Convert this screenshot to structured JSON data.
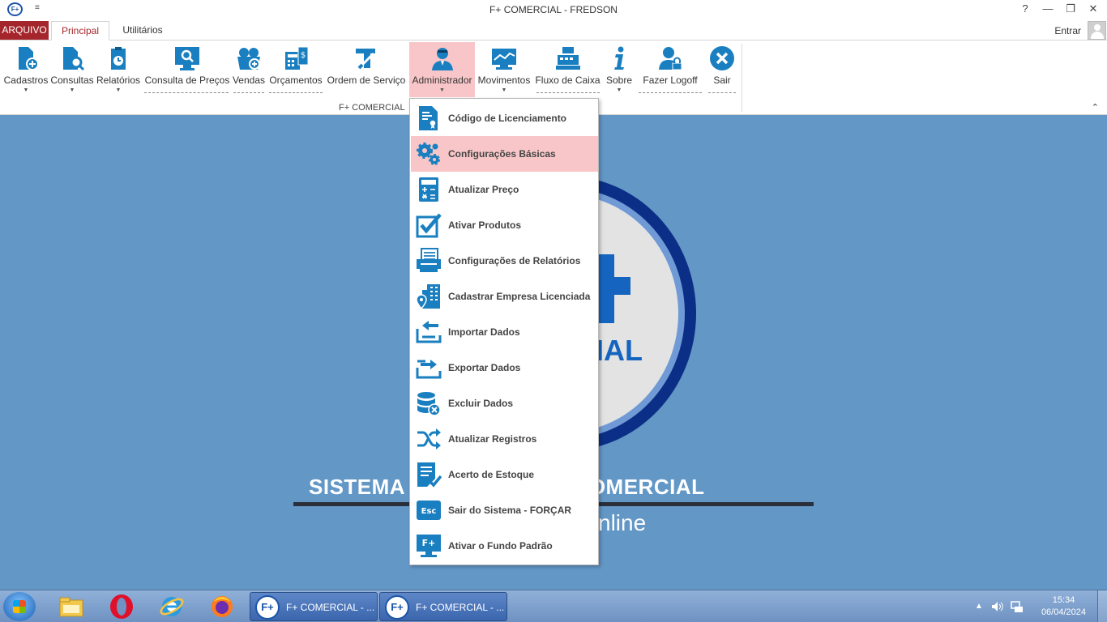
{
  "window": {
    "title": "F+ COMERCIAL - FREDSON",
    "app_icon_label": "F+",
    "quick_access": "≡",
    "controls": [
      "?",
      "—",
      "❐",
      "✕"
    ]
  },
  "tabs": {
    "file": "ARQUIVO",
    "items": [
      "Principal",
      "Utilitários"
    ],
    "active": "Principal",
    "signin": "Entrar"
  },
  "ribbon": {
    "buttons": [
      {
        "label": "Cadastros",
        "icon": "document-plus-icon",
        "has_arrow": true
      },
      {
        "label": "Consultas",
        "icon": "document-search-icon",
        "has_arrow": true
      },
      {
        "label": "Relatórios",
        "icon": "clipboard-clock-icon",
        "has_arrow": true
      },
      {
        "label": "Consulta de Preços",
        "icon": "monitor-search-icon",
        "has_arrow": false
      },
      {
        "label": "Vendas",
        "icon": "basket-plus-icon",
        "has_arrow": false
      },
      {
        "label": "Orçamentos",
        "icon": "calculator-document-icon",
        "has_arrow": false
      },
      {
        "label": "Ordem de Serviço",
        "icon": "tools-icon",
        "has_arrow": false
      },
      {
        "label": "Administrador",
        "icon": "admin-user-icon",
        "has_arrow": true
      },
      {
        "label": "Movimentos",
        "icon": "monitor-chart-icon",
        "has_arrow": true
      },
      {
        "label": "Fluxo de Caixa",
        "icon": "cash-register-icon",
        "has_arrow": false
      },
      {
        "label": "Sobre",
        "icon": "info-icon",
        "has_arrow": true
      },
      {
        "label": "Fazer Logoff",
        "icon": "user-lock-icon",
        "has_arrow": false
      },
      {
        "label": "Sair",
        "icon": "close-circle-icon",
        "has_arrow": false
      }
    ],
    "group_label": "F+ COMERCIAL",
    "collapse_icon": "⌃"
  },
  "menu": {
    "items": [
      {
        "label": "Código de Licenciamento",
        "icon": "license-certificate-icon"
      },
      {
        "label": "Configurações Básicas",
        "icon": "gears-icon",
        "highlighted": true
      },
      {
        "label": "Atualizar Preço",
        "icon": "calculator-icon"
      },
      {
        "label": "Ativar Produtos",
        "icon": "checkbox-icon"
      },
      {
        "label": "Configurações de Relatórios",
        "icon": "printer-report-icon"
      },
      {
        "label": "Cadastrar Empresa Licenciada",
        "icon": "building-location-icon"
      },
      {
        "label": "Importar Dados",
        "icon": "import-icon"
      },
      {
        "label": "Exportar Dados",
        "icon": "export-icon"
      },
      {
        "label": "Excluir Dados",
        "icon": "database-delete-icon"
      },
      {
        "label": "Atualizar Registros",
        "icon": "shuffle-icon"
      },
      {
        "label": "Acerto de Estoque",
        "icon": "stock-list-icon"
      },
      {
        "label": "Sair do Sistema - FORÇAR",
        "icon": "esc-key-icon",
        "icon_text": "Esc"
      },
      {
        "label": "Ativar o Fundo Padrão",
        "icon": "monitor-fplus-icon",
        "icon_text": "F+"
      }
    ]
  },
  "background": {
    "slogan": "SISTEMA DE GERENCIAMENTO COMERCIAL",
    "slogan_visible_left": "SISTEMA",
    "slogan_visible_right": "ENTO COMERCIAL",
    "logo_text": "IAL",
    "online": "nline"
  },
  "taskbar": {
    "apps": [
      "file-explorer-icon",
      "opera-icon",
      "internet-explorer-icon",
      "firefox-icon"
    ],
    "tasks": [
      {
        "label": "F+ COMERCIAL - ...",
        "icon_text": "F+"
      },
      {
        "label": "F+ COMERCIAL - ...",
        "icon_text": "F+"
      }
    ],
    "time": "15:34",
    "date": "06/04/2024"
  },
  "colors": {
    "accent": "#a4262c",
    "icon_blue": "#1a7fc0",
    "highlight": "#f8c6c8",
    "desktop": "#6397c6"
  }
}
